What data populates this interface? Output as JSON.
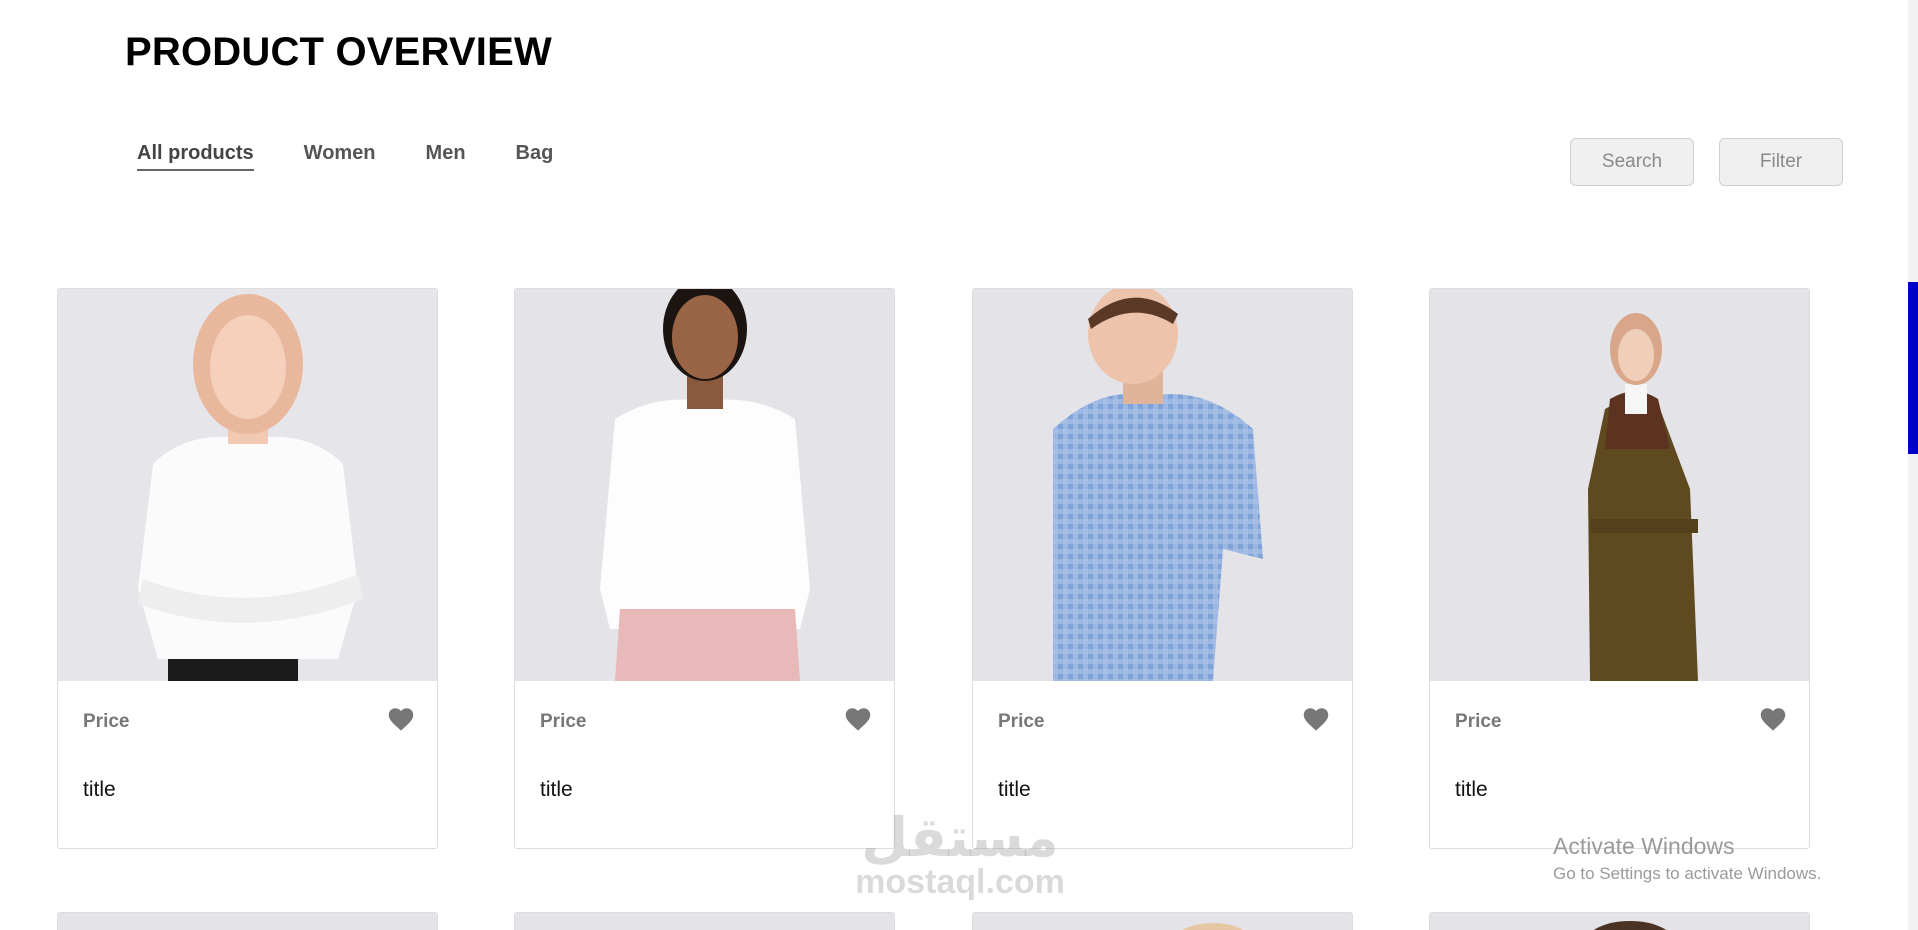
{
  "page": {
    "title": "PRODUCT OVERVIEW"
  },
  "tabs": [
    {
      "label": "All products",
      "active": true
    },
    {
      "label": "Women",
      "active": false
    },
    {
      "label": "Men",
      "active": false
    },
    {
      "label": "Bag",
      "active": false
    }
  ],
  "actions": {
    "search_label": "Search",
    "filter_label": "Filter"
  },
  "products": [
    {
      "price_label": "Price",
      "title": "title",
      "image": "woman-white-tshirt",
      "favorite_icon": "heart-icon"
    },
    {
      "price_label": "Price",
      "title": "title",
      "image": "woman-white-shirt-pink-pants",
      "favorite_icon": "heart-icon"
    },
    {
      "price_label": "Price",
      "title": "title",
      "image": "man-blue-check-shirt",
      "favorite_icon": "heart-icon"
    },
    {
      "price_label": "Price",
      "title": "title",
      "image": "woman-olive-coat",
      "favorite_icon": "heart-icon"
    }
  ],
  "watermark": {
    "logo_text": "مستقل",
    "url": "mostaql.com"
  },
  "os_notice": {
    "title": "Activate Windows",
    "subtitle": "Go to Settings to activate Windows."
  },
  "colors": {
    "accent_scroll": "#0000c8",
    "heart": "#777777",
    "image_bg": "#e4e4e8"
  }
}
